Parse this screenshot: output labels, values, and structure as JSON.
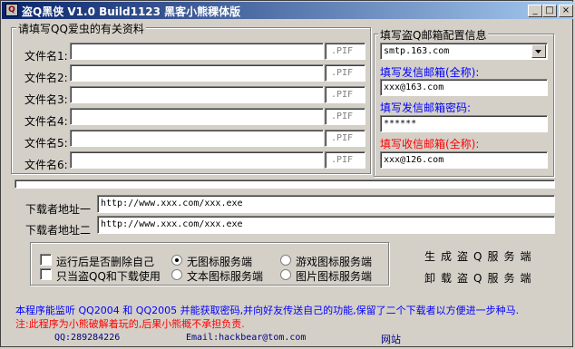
{
  "window": {
    "title": "盗Q黑侠 V1.0 Build1123  黑客小熊稞体版",
    "minimize": "_",
    "maximize": "□",
    "close": "×"
  },
  "files_group": {
    "legend": "请填写QQ爱虫的有关资料",
    "rows": [
      {
        "label": "文件名1:",
        "value": "",
        "ext": ".PIF"
      },
      {
        "label": "文件名2:",
        "value": "",
        "ext": ".PIF"
      },
      {
        "label": "文件名3:",
        "value": "",
        "ext": ".PIF"
      },
      {
        "label": "文件名4:",
        "value": "",
        "ext": ".PIF"
      },
      {
        "label": "文件名5:",
        "value": "",
        "ext": ".PIF"
      },
      {
        "label": "文件名6:",
        "value": "",
        "ext": ".PIF"
      }
    ]
  },
  "mail_group": {
    "legend": "填写盗Q邮箱配置信息",
    "smtp_value": "smtp.163.com",
    "sender_label": "填写发信邮箱(全称):",
    "sender_value": "xxx@163.com",
    "password_label": "填写发信邮箱密码:",
    "password_value": "******",
    "receiver_label": "填写收信邮箱(全称):",
    "receiver_value": "xxx@126.com"
  },
  "download": {
    "url1_label": "下载者地址一",
    "url1_value": "http://www.xxx.com/xxx.exe",
    "url2_label": "下载者地址二",
    "url2_value": "http://www.xxx.com/xxx.exe"
  },
  "options": {
    "delete_after_run": "运行后是否删除自己",
    "download_only": "只当盗QQ和下载使用",
    "no_icon": "无图标服务端",
    "text_icon": "文本图标服务端",
    "game_icon": "游戏图标服务端",
    "picture_icon": "图片图标服务端"
  },
  "actions": {
    "generate": "生成盗Q服务端",
    "uninstall": "卸载盗Q服务端"
  },
  "footer": {
    "description": "本程序能监听 QQ2004 和 QQ2005 并能获取密码,并向好友传送自己的功能,保留了二个下载者以方便进一步种马.",
    "warning": "注:此程序为小熊破解着玩的,后果小熊概不承担负责.",
    "qq": "QQ:289284226",
    "email": "Email:hackbear@tom.com",
    "website": "网站"
  }
}
